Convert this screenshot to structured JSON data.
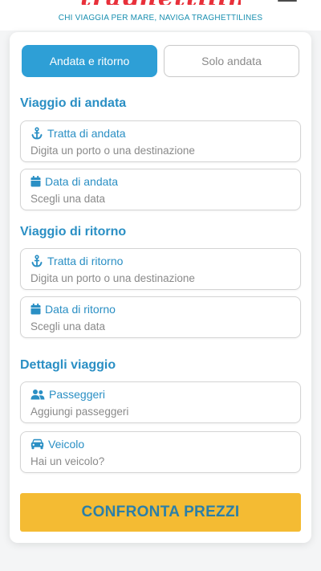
{
  "header": {
    "logo_text": "traghettilines",
    "tagline": "CHI VIAGGIA PER MARE, NAVIGA TRAGHETTILINES"
  },
  "trip_type": {
    "round_trip": "Andata e ritorno",
    "one_way": "Solo andata"
  },
  "outbound": {
    "title": "Viaggio di andata",
    "route_label": "Tratta di andata",
    "route_placeholder": "Digita un porto o una destinazione",
    "date_label": "Data di andata",
    "date_placeholder": "Scegli una data"
  },
  "return": {
    "title": "Viaggio di ritorno",
    "route_label": "Tratta di ritorno",
    "route_placeholder": "Digita un porto o una destinazione",
    "date_label": "Data di ritorno",
    "date_placeholder": "Scegli una data"
  },
  "details": {
    "title": "Dettagli viaggio",
    "passengers_label": "Passeggeri",
    "passengers_placeholder": "Aggiungi passeggeri",
    "vehicle_label": "Veicolo",
    "vehicle_placeholder": "Hai un veicolo?"
  },
  "cta_label": "CONFRONTA PREZZI",
  "icons": {
    "route": "anchor-icon",
    "date": "calendar-icon",
    "passengers": "users-icon",
    "vehicle": "car-icon",
    "menu": "hamburger-menu-icon"
  },
  "colors": {
    "primary": "#2e9fd6",
    "label": "#2a8fc4",
    "cta": "#f4bb33",
    "logo": "#e8303a"
  }
}
